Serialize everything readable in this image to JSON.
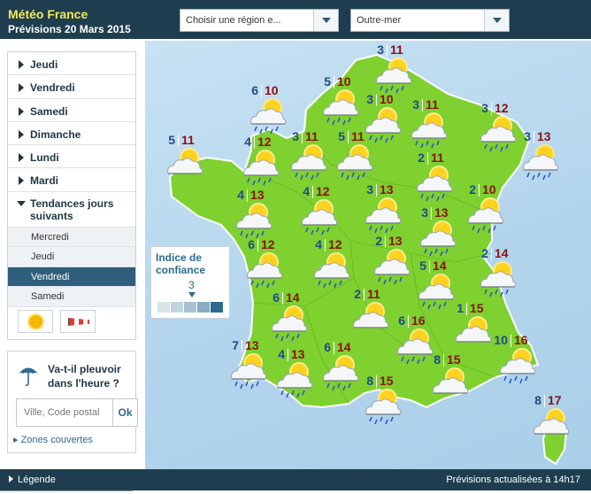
{
  "header": {
    "brand": "Météo France",
    "subtitle": "Prévisions 20 Mars 2015",
    "region_select": "Choisir une région e...",
    "outremer_select": "Outre-mer"
  },
  "sidebar": {
    "days": [
      "Jeudi",
      "Vendredi",
      "Samedi",
      "Dimanche",
      "Lundi",
      "Mardi"
    ],
    "open_section": "Tendances jours suivants",
    "subitems": [
      "Mercredi",
      "Jeudi",
      "Vendredi",
      "Samedi"
    ],
    "active_subitem": "Vendredi",
    "legend_icons": [
      "sun-icon",
      "windsock-icon"
    ]
  },
  "rain": {
    "question_line1": "Va-t-il pleuvoir",
    "question_line2": "dans l'heure ?",
    "placeholder": "Ville, Code postal",
    "button": "Ok",
    "link": "Zones couvertes"
  },
  "confidence": {
    "title_line1": "Indice de",
    "title_line2": "confiance",
    "value": "3",
    "max": 5
  },
  "colors": {
    "header_bg": "#1e3e4f",
    "brand": "#f2e95a",
    "land": "#7ed12f",
    "sea": "#b3d5ec",
    "min_temp": "#1f4a88",
    "max_temp": "#8c1010",
    "active_item": "#2f5f7c"
  },
  "forecasts": [
    {
      "min": "3",
      "max": "11",
      "icon": "sun-cloud-rain"
    },
    {
      "min": "6",
      "max": "10",
      "icon": "sun-cloud-rain"
    },
    {
      "min": "5",
      "max": "10",
      "icon": "sun-cloud-rain"
    },
    {
      "min": "3",
      "max": "10",
      "icon": "sun-cloud-rain"
    },
    {
      "min": "3",
      "max": "11",
      "icon": "sun-cloud-rain"
    },
    {
      "min": "3",
      "max": "12",
      "icon": "sun-cloud-rain"
    },
    {
      "min": "5",
      "max": "11",
      "icon": "sun-cloud"
    },
    {
      "min": "4",
      "max": "12",
      "icon": "sun-cloud-rain"
    },
    {
      "min": "3",
      "max": "11",
      "icon": "sun-cloud-rain"
    },
    {
      "min": "5",
      "max": "11",
      "icon": "sun-cloud-rain"
    },
    {
      "min": "2",
      "max": "11",
      "icon": "sun-cloud-rain"
    },
    {
      "min": "3",
      "max": "13",
      "icon": "sun-cloud-rain"
    },
    {
      "min": "4",
      "max": "13",
      "icon": "sun-cloud-rain"
    },
    {
      "min": "4",
      "max": "12",
      "icon": "sun-cloud-rain"
    },
    {
      "min": "3",
      "max": "13",
      "icon": "sun-cloud-rain"
    },
    {
      "min": "2",
      "max": "10",
      "icon": "sun-cloud-rain"
    },
    {
      "min": "3",
      "max": "13",
      "icon": "sun-cloud-rain"
    },
    {
      "min": "6",
      "max": "12",
      "icon": "sun-cloud-rain"
    },
    {
      "min": "4",
      "max": "12",
      "icon": "sun-cloud-rain"
    },
    {
      "min": "2",
      "max": "13",
      "icon": "sun-cloud-rain"
    },
    {
      "min": "5",
      "max": "14",
      "icon": "sun-cloud-rain"
    },
    {
      "min": "2",
      "max": "14",
      "icon": "sun-cloud-rain"
    },
    {
      "min": "6",
      "max": "14",
      "icon": "sun-cloud-rain"
    },
    {
      "min": "2",
      "max": "11",
      "icon": "sun-cloud"
    },
    {
      "min": "6",
      "max": "16",
      "icon": "sun-cloud-rain"
    },
    {
      "min": "1",
      "max": "15",
      "icon": "sun-cloud"
    },
    {
      "min": "7",
      "max": "13",
      "icon": "sun-cloud-rain"
    },
    {
      "min": "4",
      "max": "13",
      "icon": "sun-cloud-rain"
    },
    {
      "min": "6",
      "max": "14",
      "icon": "sun-cloud-rain"
    },
    {
      "min": "8",
      "max": "15",
      "icon": "sun-cloud-rain"
    },
    {
      "min": "8",
      "max": "15",
      "icon": "sun-cloud"
    },
    {
      "min": "10",
      "max": "16",
      "icon": "sun-cloud-rain"
    },
    {
      "min": "8",
      "max": "17",
      "icon": "sun-cloud"
    }
  ],
  "footer": {
    "legend": "Légende",
    "updated": "Prévisions actualisées à 14h17"
  }
}
